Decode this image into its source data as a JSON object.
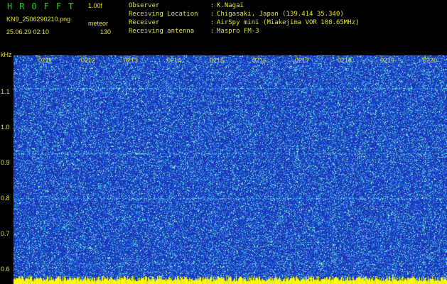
{
  "header": {
    "app_title": "HROFFT",
    "version": "1.00f",
    "filename": "KN9_2506290210.png",
    "mode": "meteor",
    "datetime": "25.06.29 02:10",
    "count": "130"
  },
  "meta": [
    {
      "label": "Observer",
      "value": "K.Nagai"
    },
    {
      "label": "Receiving Location",
      "value": "Chigasaki, Japan (139.414 35.340)"
    },
    {
      "label": "Receiver",
      "value": "AirSpy mini (Miakejima VOR 108.65MHz)"
    },
    {
      "label": "Receiving antenna",
      "value": "Maspro FM-3"
    }
  ],
  "colon": ":",
  "axis": {
    "unit": "kHz",
    "y_ticks": [
      "1.1",
      "1.0",
      "0.9",
      "0.8",
      "0.7",
      "0.6"
    ],
    "x_ticks": [
      "0211",
      "0212",
      "0213",
      "0214",
      "0215",
      "0216",
      "0217",
      "0218",
      "0219",
      "0220"
    ]
  },
  "colors": {
    "background": "#000000",
    "label_yellow": "#e3e32a",
    "title_green": "#1fd11f",
    "spectrum_base": "#1c38c0",
    "signal_cyan": "#7ce8d8",
    "marker_yellow": "#ffff00"
  }
}
